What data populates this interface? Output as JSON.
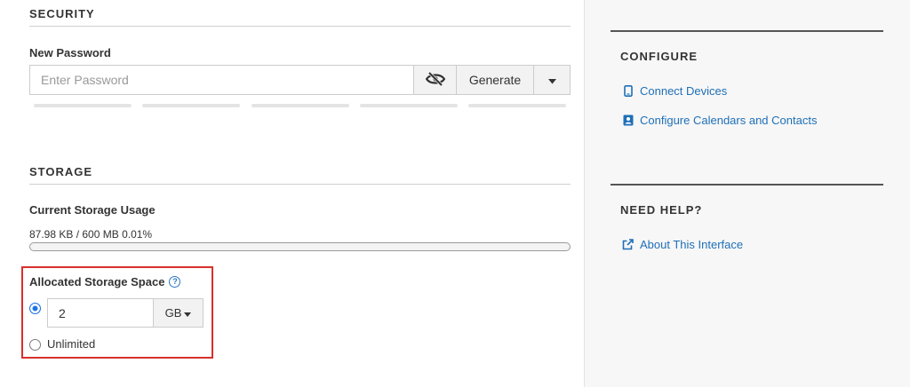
{
  "security": {
    "title": "SECURITY",
    "new_password_label": "New Password",
    "password_placeholder": "Enter Password",
    "generate_label": "Generate"
  },
  "storage": {
    "title": "STORAGE",
    "usage_label": "Current Storage Usage",
    "usage_text": "87.98 KB / 600 MB 0.01%",
    "usage_percent": 0.01,
    "allocated_label": "Allocated Storage Space",
    "allocated_value": "2",
    "allocated_unit": "GB",
    "unlimited_label": "Unlimited"
  },
  "sidebar": {
    "configure_title": "CONFIGURE",
    "connect_devices": "Connect Devices",
    "configure_calendars": "Configure Calendars and Contacts",
    "help_title": "NEED HELP?",
    "about_interface": "About This Interface"
  },
  "colors": {
    "accent": "#1f6fb7",
    "highlight_border": "#d9302c",
    "radio_checked": "#1b74e8"
  },
  "icons": [
    "hidden-eye-icon",
    "caret-down-icon",
    "help-circle-icon",
    "mobile-device-icon",
    "address-book-icon",
    "external-link-icon"
  ]
}
